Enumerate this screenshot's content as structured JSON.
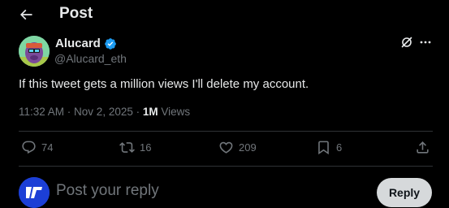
{
  "header": {
    "title": "Post"
  },
  "author": {
    "name": "Alucard",
    "handle": "@Alucard_eth"
  },
  "tweet": {
    "text": "If this tweet gets a million views I'll delete my account.",
    "time": "11:32 AM",
    "separator1": " · ",
    "date": "Nov 2, 2025",
    "separator2": " · ",
    "views_count": "1M",
    "views_label": " Views"
  },
  "actions": {
    "replies": "74",
    "reposts": "16",
    "likes": "209",
    "bookmarks": "6"
  },
  "reply": {
    "placeholder": "Post your reply",
    "button_label": "Reply"
  },
  "colors": {
    "background": "#000000",
    "text": "#e7e9ea",
    "secondary": "#71767b",
    "divider": "#2f3336",
    "verified": "#1d9bf0",
    "reply_button": "#d6d9db"
  }
}
